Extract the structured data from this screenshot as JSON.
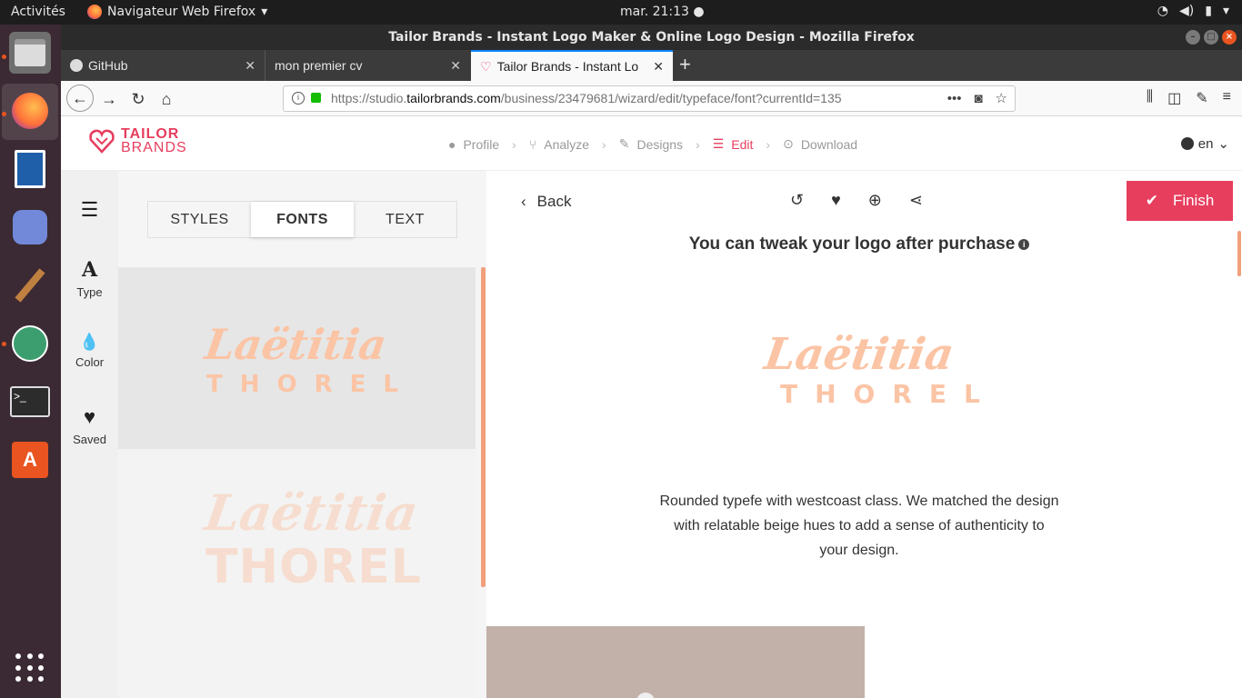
{
  "os": {
    "activities": "Activités",
    "app_name": "Navigateur Web Firefox",
    "clock": "mar. 21:13"
  },
  "window": {
    "title": "Tailor Brands - Instant Logo Maker & Online Logo Design - Mozilla Firefox"
  },
  "tabs": [
    {
      "label": "GitHub"
    },
    {
      "label": "mon premier cv"
    },
    {
      "label": "Tailor Brands - Instant Lo"
    }
  ],
  "urlbar": {
    "prefix": "https://studio.",
    "domain": "tailorbrands.com",
    "path": "/business/23479681/wizard/edit/typeface/font?currentId=135"
  },
  "brand": {
    "line1": "TAILOR",
    "line2": "BRANDS",
    "color": "#e73e5e"
  },
  "steps": [
    {
      "label": "Profile"
    },
    {
      "label": "Analyze"
    },
    {
      "label": "Designs"
    },
    {
      "label": "Edit"
    },
    {
      "label": "Download"
    }
  ],
  "lang": "en",
  "rail": {
    "type": "Type",
    "color": "Color",
    "saved": "Saved"
  },
  "segments": {
    "styles": "STYLES",
    "fonts": "FONTS",
    "text": "TEXT"
  },
  "logo_text": {
    "first": "Laëtitia",
    "last": "THOREL"
  },
  "main": {
    "back": "Back",
    "finish": "Finish",
    "headline": "You can tweak your logo after purchase",
    "description": "Rounded typefe with westcoast class. We matched the design with relatable beige hues to add a sense of authenticity to your design."
  }
}
